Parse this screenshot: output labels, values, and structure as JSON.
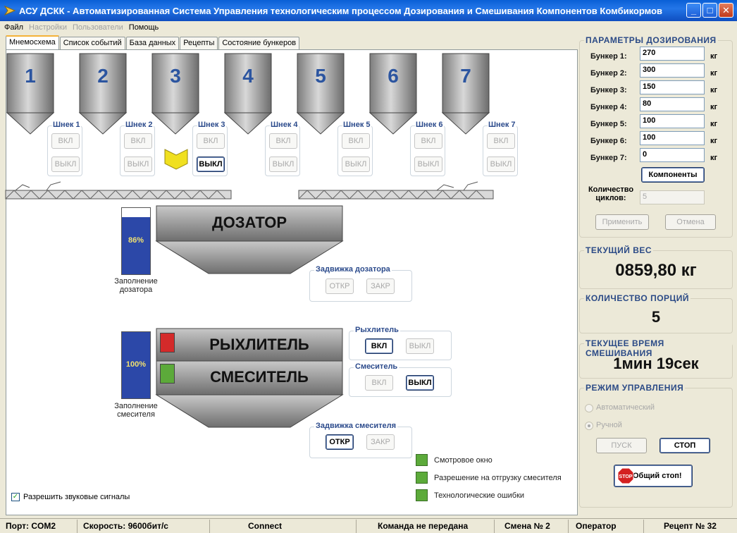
{
  "window": {
    "title": "АСУ ДСКК - Автоматизированная Система Управления технологическим процессом Дозирования и Смешивания Компонентов Комбикормов",
    "btn_min": "_",
    "btn_max": "□",
    "btn_close": "✕"
  },
  "menu": {
    "items": [
      "Файл",
      "Настройки",
      "Пользователи",
      "Помощь"
    ]
  },
  "tabs": [
    "Мнемосхема",
    "Список событий",
    "База данных",
    "Рецепты",
    "Состояние бункеров"
  ],
  "hoppers": [
    "1",
    "2",
    "3",
    "4",
    "5",
    "6",
    "7"
  ],
  "screws": [
    {
      "label": "Шнек 1",
      "on": "ВКЛ",
      "off": "ВЫКЛ"
    },
    {
      "label": "Шнек 2",
      "on": "ВКЛ",
      "off": "ВЫКЛ"
    },
    {
      "label": "Шнек 3",
      "on": "ВКЛ",
      "off": "ВЫКЛ"
    },
    {
      "label": "Шнек 4",
      "on": "ВКЛ",
      "off": "ВЫКЛ"
    },
    {
      "label": "Шнек 5",
      "on": "ВКЛ",
      "off": "ВЫКЛ"
    },
    {
      "label": "Шнек 6",
      "on": "ВКЛ",
      "off": "ВЫКЛ"
    },
    {
      "label": "Шнек 7",
      "on": "ВКЛ",
      "off": "ВЫКЛ"
    }
  ],
  "dosator": {
    "title": "ДОЗАТОР",
    "fill_percent": 86,
    "fill_label": "86%",
    "caption": "Заполнение дозатора",
    "gate": {
      "label": "Задвижка дозатора",
      "open": "ОТКР",
      "close": "ЗАКР"
    }
  },
  "mixer": {
    "title_loosener": "РЫХЛИТЕЛЬ",
    "title_mixer": "СМЕСИТЕЛЬ",
    "fill_percent": 100,
    "fill_label": "100%",
    "caption": "Заполнение смесителя",
    "loosener_group": {
      "label": "Рыхлитель",
      "on": "ВКЛ",
      "off": "ВЫКЛ"
    },
    "mixer_group": {
      "label": "Смеситель",
      "on": "ВКЛ",
      "off": "ВЫКЛ"
    },
    "gate": {
      "label": "Задвижка смесителя",
      "open": "ОТКР",
      "close": "ЗАКР"
    },
    "indicator_loosener": "#d42a2a",
    "indicator_mixer": "#5caa3a"
  },
  "legend": [
    "Смотровое окно",
    "Разрешение на отгрузку смесителя",
    "Технологические ошибки"
  ],
  "sound_checkbox": "Разрешить звуковые сигналы",
  "params": {
    "title": "ПАРАМЕТРЫ ДОЗИРОВАНИЯ",
    "rows": [
      {
        "label": "Бункер 1:",
        "value": "270",
        "unit": "кг"
      },
      {
        "label": "Бункер 2:",
        "value": "300",
        "unit": "кг"
      },
      {
        "label": "Бункер 3:",
        "value": "150",
        "unit": "кг"
      },
      {
        "label": "Бункер 4:",
        "value": "80",
        "unit": "кг"
      },
      {
        "label": "Бункер 5:",
        "value": "100",
        "unit": "кг"
      },
      {
        "label": "Бункер 6:",
        "value": "100",
        "unit": "кг"
      },
      {
        "label": "Бункер 7:",
        "value": "0",
        "unit": "кг"
      }
    ],
    "components_button": "Компоненты",
    "cycles_label_1": "Количество",
    "cycles_label_2": "циклов:",
    "cycles_value": "5",
    "apply": "Применить",
    "cancel": "Отмена"
  },
  "current_weight": {
    "title": "ТЕКУЩИЙ ВЕС",
    "value": "0859,80 кг"
  },
  "portions": {
    "title": "КОЛИЧЕСТВО ПОРЦИЙ",
    "value": "5"
  },
  "mix_time": {
    "title": "ТЕКУЩЕЕ ВРЕМЯ СМЕШИВАНИЯ",
    "value": "1мин 19сек"
  },
  "mode": {
    "title": "РЕЖИМ УПРАВЛЕНИЯ",
    "auto": "Автоматический",
    "manual": "Ручной",
    "start": "ПУСК",
    "stop": "СТОП",
    "emergency": "Общий стоп!",
    "stop_sign": "STOP"
  },
  "status": {
    "port": "Порт: COM2",
    "speed": "Скорость: 9600бит/с",
    "connect": "Connect",
    "command": "Команда не передана",
    "shift": "Смена № 2",
    "role": "Оператор",
    "recipe": "Рецепт № 32"
  }
}
